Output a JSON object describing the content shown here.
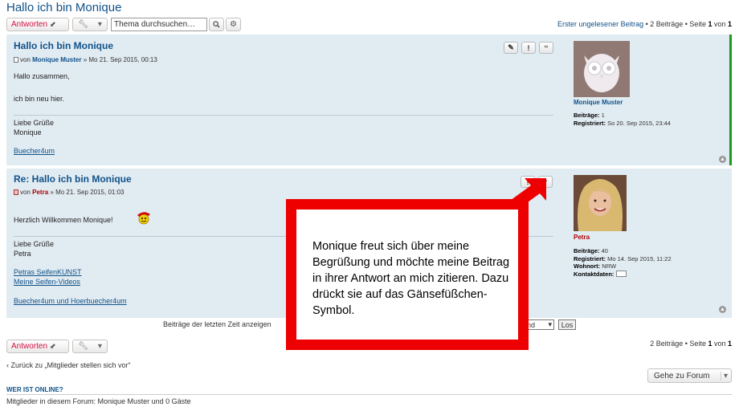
{
  "topic": {
    "title": "Hallo ich bin Monique"
  },
  "toolbar": {
    "reply_label": "Antworten",
    "search_placeholder": "Thema durchsuchen…",
    "search_value": "Thema durchsuchen…"
  },
  "pagination_top": {
    "first_unread": "Erster ungelesener Beitrag",
    "sep1": " • ",
    "count": "2 Beiträge",
    "sep2": " • Seite ",
    "page": "1",
    "of": " von ",
    "total": "1"
  },
  "posts": [
    {
      "title": "Hallo ich bin Monique",
      "by": "von",
      "author": "Monique Muster",
      "date": "» Mo 21. Sep 2015, 00:13",
      "lines": [
        "Hallo zusammen,",
        "ich bin neu hier."
      ],
      "sig_lines": [
        "Liebe Grüße",
        "Monique"
      ],
      "links": [
        "Buecher4um"
      ],
      "profile": {
        "name": "Monique Muster",
        "posts_label": "Beiträge:",
        "posts": "1",
        "registered_label": "Registriert:",
        "registered": "So 20. Sep 2015, 23:44"
      }
    },
    {
      "title": "Re: Hallo ich bin Monique",
      "by": "von",
      "author": "Petra",
      "date": "» Mo 21. Sep 2015, 01:03",
      "lines": [
        "Herzlich Willkommen Monique!"
      ],
      "sig_lines": [
        "Liebe Grüße",
        "Petra"
      ],
      "links": [
        "Petras SeifenKUNST",
        "Meine Seifen-Videos",
        "Buecher4um und Hoerbuecher4um"
      ],
      "profile": {
        "name": "Petra",
        "posts_label": "Beiträge:",
        "posts": "40",
        "registered_label": "Registriert:",
        "registered": "Mo 14. Sep 2015, 11:22",
        "location_label": "Wohnort:",
        "location": "NRW",
        "contact_label": "Kontaktdaten:"
      }
    }
  ],
  "post_buttons": {
    "edit": "✎",
    "report": "!",
    "quote": "‘‘"
  },
  "filter": {
    "label": "Beiträge der letzten Zeit anzeigen",
    "sort_value": "end",
    "go": "Los"
  },
  "pagination_bottom": {
    "count": "2 Beiträge",
    "sep": " • Seite ",
    "page": "1",
    "of": " von ",
    "total": "1"
  },
  "back_link": "‹ Zurück zu „Mitglieder stellen sich vor“",
  "jump": {
    "label": "Gehe zu Forum"
  },
  "online": {
    "heading": "WER IST ONLINE?",
    "text": "Mitglieder in diesem Forum: Monique Muster und 0 Gäste"
  },
  "annotation": {
    "text": "Monique freut sich über meine Begrüßung und möchte meine Beitrag in ihrer Antwort an mich zitieren. Dazu drückt sie auf das Gänsefüßchen-Symbol."
  },
  "colors": {
    "accent": "#105289",
    "post_bg": "#e1ebf2",
    "reply": "#d31141",
    "overlay": "#ee0000",
    "online_bar": "#1b9a1b"
  }
}
